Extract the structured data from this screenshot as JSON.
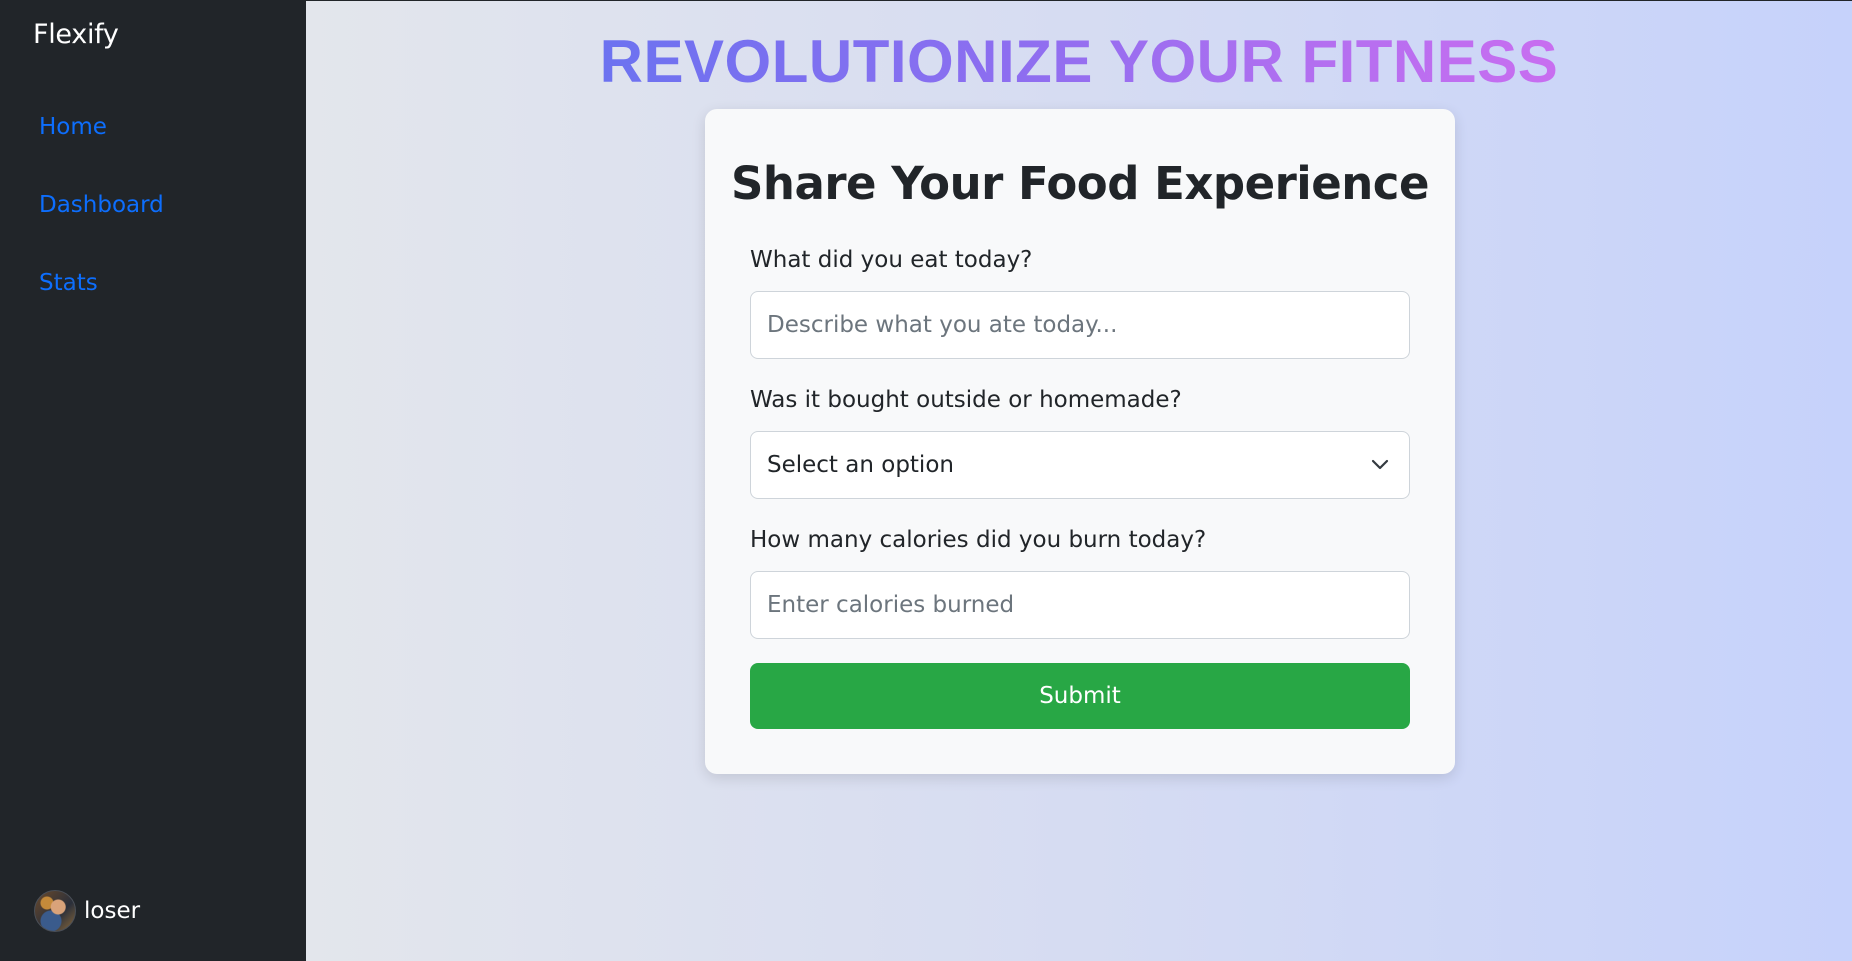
{
  "sidebar": {
    "brand": "Flexify",
    "nav": [
      {
        "label": "Home"
      },
      {
        "label": "Dashboard"
      },
      {
        "label": "Stats"
      }
    ],
    "user": {
      "name": "loser"
    }
  },
  "hero": {
    "title": "REVOLUTIONIZE YOUR FITNESS"
  },
  "form": {
    "title": "Share Your Food Experience",
    "food": {
      "label": "What did you eat today?",
      "placeholder": "Describe what you ate today...",
      "value": ""
    },
    "source": {
      "label": "Was it bought outside or homemade?",
      "selected": "Select an option"
    },
    "calories": {
      "label": "How many calories did you burn today?",
      "placeholder": "Enter calories burned",
      "value": ""
    },
    "submit_label": "Submit"
  },
  "colors": {
    "sidebar_bg": "#212529",
    "link": "#0d6efd",
    "submit_bg": "#28a745",
    "hero_gradient_start": "#6c72f0",
    "hero_gradient_end": "#c86ef0"
  },
  "icons": {
    "select_arrow": "chevron-down-icon",
    "user_avatar": "avatar"
  }
}
